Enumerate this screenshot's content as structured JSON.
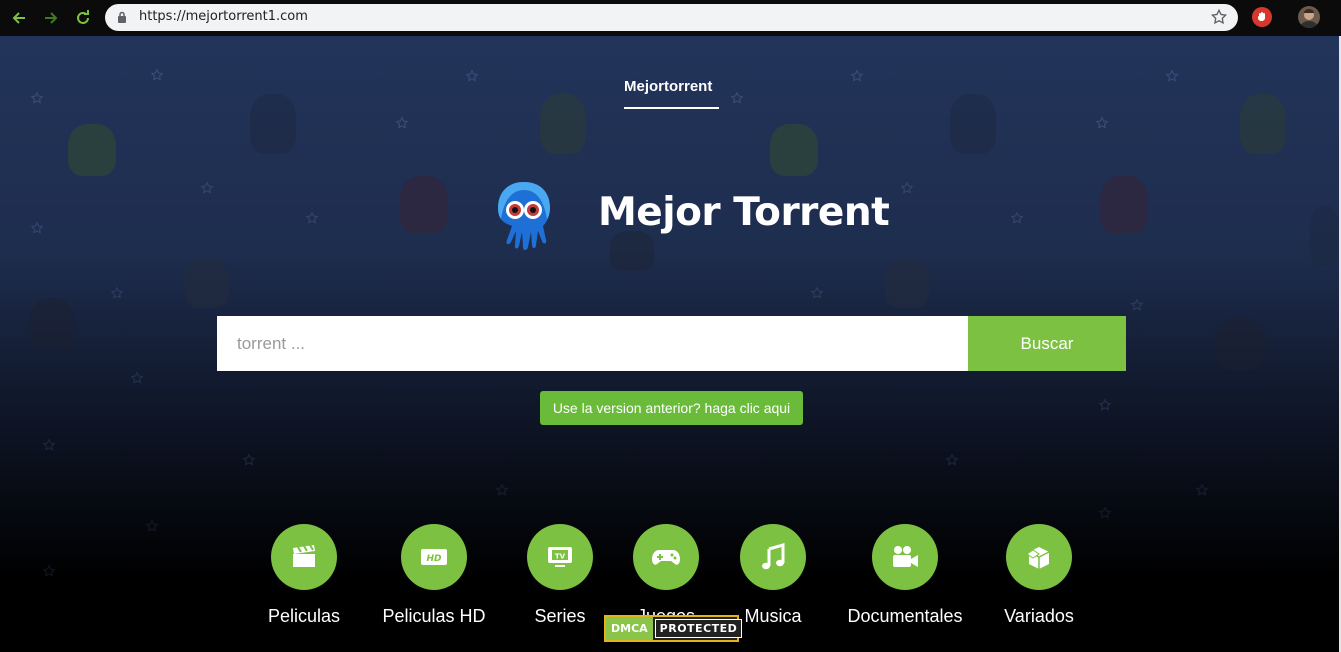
{
  "browser": {
    "url": "https://mejortorrent1.com"
  },
  "nav": {
    "top_link": "Mejortorrent"
  },
  "brand": {
    "title": "Mejor Torrent"
  },
  "search": {
    "placeholder": "torrent ...",
    "value": "",
    "button_label": "Buscar"
  },
  "old_version": {
    "label": "Use la version anterior? haga clic aqui"
  },
  "categories": [
    {
      "label": "Peliculas",
      "icon": "clapperboard-icon"
    },
    {
      "label": "Peliculas HD",
      "icon": "hd-icon"
    },
    {
      "label": "Series",
      "icon": "tv-icon"
    },
    {
      "label": "Juegos",
      "icon": "gamepad-icon"
    },
    {
      "label": "Musica",
      "icon": "music-note-icon"
    },
    {
      "label": "Documentales",
      "icon": "video-camera-icon"
    },
    {
      "label": "Variados",
      "icon": "box-icon"
    }
  ],
  "dmca": {
    "left": "DMCA",
    "right": "PROTECTED"
  },
  "colors": {
    "accent": "#7cc142",
    "background_top": "#22345a"
  }
}
